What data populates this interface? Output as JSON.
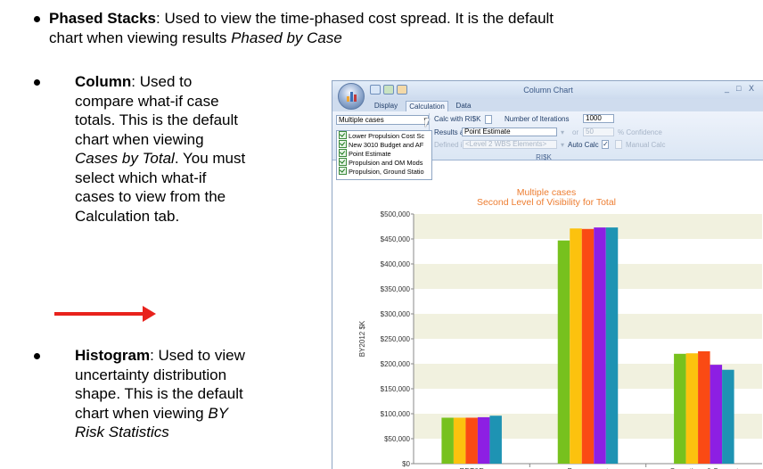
{
  "document": {
    "bullets": [
      {
        "term": "Phased Stacks",
        "line1": ": Used to view the time-phased cost spread. It is the default",
        "line2_plain": "chart when viewing results ",
        "line2_italic": "Phased by Case"
      },
      {
        "term": "Column",
        "line1": ": Used to",
        "lines": [
          "compare what-if case",
          "totals. This is the default",
          "chart when viewing"
        ],
        "italic_line": "Cases by Total",
        "after_italic": ". You must",
        "more_lines": [
          "select which what-if",
          "cases to view from the",
          "Calculation tab."
        ]
      },
      {
        "term": "Histogram",
        "line1": ": Used to view",
        "lines": [
          "uncertainty distribution",
          "shape. This is the default"
        ],
        "plain_before_italic": "chart when viewing ",
        "italic_1": "BY",
        "italic_2": "Risk Statistics"
      }
    ],
    "arrow_color": "#e8221c"
  },
  "window": {
    "title": "Column Chart",
    "controls": [
      "_",
      "□",
      "X"
    ],
    "tabs": [
      "Display",
      "Calculation",
      "Data"
    ],
    "active_tab": "Calculation",
    "cases_combo": "Multiple cases",
    "cases_list": [
      "Lower Propulsion Cost Sc",
      "New 3010 Budget and AF",
      "Point Estimate",
      "Propulsion and OM Mods",
      "Propulsion, Ground Statio"
    ],
    "calc_with_risk": "Calc with RI$K",
    "num_iterations_label": "Number of Iterations",
    "num_iterations_value": "1000",
    "results_as_label": "Results as",
    "results_as_value": "Point Estimate",
    "or_label": "or",
    "confidence_value": "50",
    "confidence_label": "% Confidence",
    "defined_in_label": "Defined in",
    "defined_in_value": "<Level 2 WBS Elements>",
    "auto_calc_label": "Auto Calc",
    "manual_calc_label": "Manual Calc",
    "group_label": "RI$K"
  },
  "chart_data": {
    "type": "bar",
    "title": "Multiple cases",
    "subtitle": "Second Level of Visibility for Total",
    "ylabel": "BY2012 $K",
    "xlabel": "",
    "categories": [
      "RDT&E",
      "Procurement",
      "Operations & Support"
    ],
    "ylim": [
      0,
      500000
    ],
    "yticks": [
      "$0",
      "$50,000",
      "$100,000",
      "$150,000",
      "$200,000",
      "$250,000",
      "$300,000",
      "$350,000",
      "$400,000",
      "$450,000",
      "$500,000"
    ],
    "colors": [
      "#77c11e",
      "#fcc20e",
      "#fa4a14",
      "#8d1fe3",
      "#1e93b3"
    ],
    "series": [
      {
        "values": [
          92000,
          447000,
          220000
        ]
      },
      {
        "values": [
          92000,
          471000,
          221000
        ]
      },
      {
        "values": [
          92000,
          470000,
          225000
        ]
      },
      {
        "values": [
          93000,
          473000,
          198000
        ]
      },
      {
        "values": [
          96000,
          473000,
          188000
        ]
      }
    ],
    "band_color": "#f1f1df"
  }
}
